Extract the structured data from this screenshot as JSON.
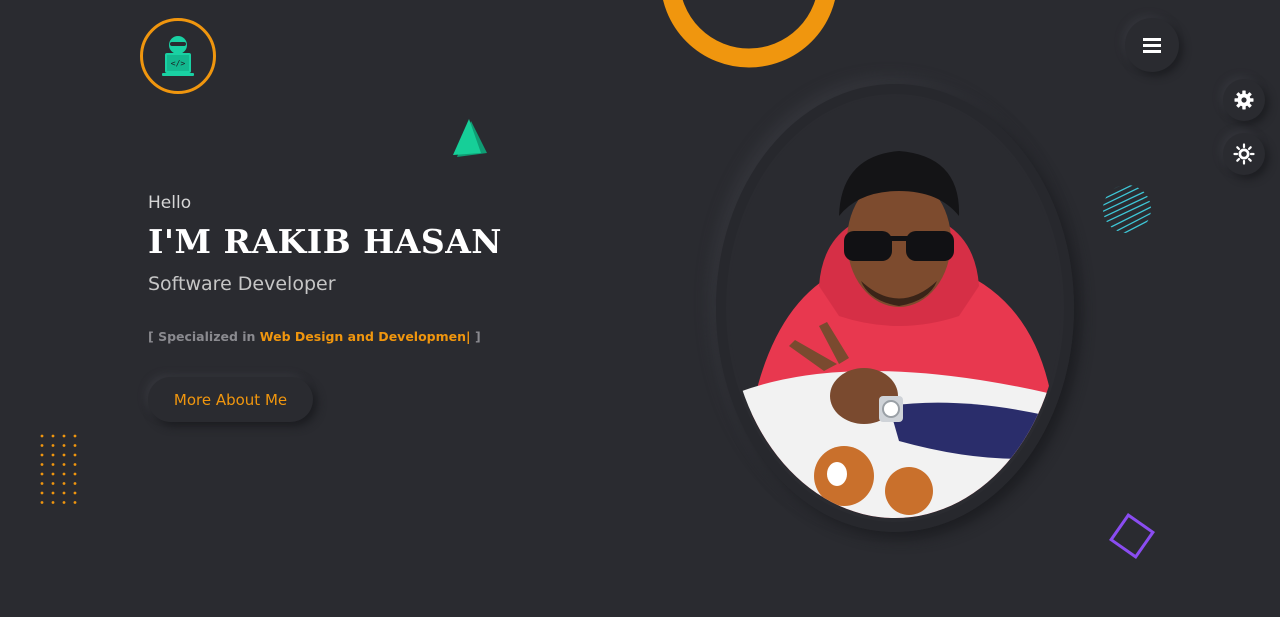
{
  "header": {
    "logo_icon": "developer-laptop-icon",
    "menu_icon": "hamburger-menu-icon"
  },
  "side_controls": [
    {
      "icon": "gear-icon"
    },
    {
      "icon": "sun-icon"
    }
  ],
  "hero": {
    "greeting": "Hello",
    "name": "I'M RAKIB HASAN",
    "role": "Software Developer",
    "specialized_prefix": "[ Specialized in ",
    "specialized_value": "Web Design and Developmen|",
    "specialized_suffix": " ]",
    "cta_label": "More About Me"
  },
  "colors": {
    "background": "#2a2b30",
    "accent": "#f0960e",
    "triangle": "#14c794",
    "diamond": "#8a4cf0",
    "stripes": "#3ec6d6"
  }
}
